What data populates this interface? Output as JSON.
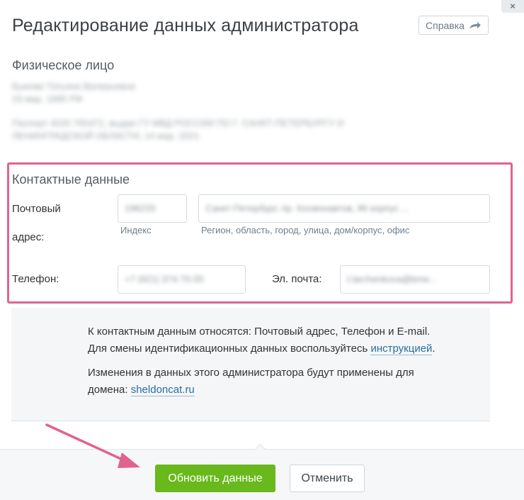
{
  "dialog": {
    "title": "Редактирование данных администратора",
    "help_label": "Справка",
    "close_label": "×"
  },
  "person": {
    "section_title": "Физическое лицо",
    "name_line": "Быкова Татьяна Валерьевна",
    "birth_line": "23 мар. 1995 РФ",
    "passport_line1": "Паспорт 4020 765472, выдан ГУ МВД РОССИИ ПО Г. САНКТ-ПЕТЕРБУРГУ И",
    "passport_line2": "ЛЕНИНГРАДСКОЙ ОБЛАСТИ, 14 мар. 2021"
  },
  "contacts": {
    "section_title": "Контактные данные",
    "postal_label_line1": "Почтовый",
    "postal_label_line2": "адрес:",
    "index_value": "196233",
    "index_hint": "Индекс",
    "address_value": "Санкт-Петербург, пр. Космонавтов, 86 корпус ...",
    "address_hint": "Регион, область, город, улица, дом/корпус, офис",
    "phone_label": "Телефон:",
    "phone_value": "+7 (921) 374-70-55",
    "email_label": "Эл. почта:",
    "email_value": "t.larchenkova@bme..."
  },
  "info": {
    "line1": "К контактным данным относятся: Почтовый адрес, Телефон и E-mail.",
    "line2_prefix": "Для смены идентификационных данных воспользуйтесь ",
    "line2_link": "инструкцией",
    "line2_suffix": ".",
    "line3": "Изменения в данных этого администратора будут применены для",
    "line4_prefix": "домена: ",
    "domain_link": "sheldoncat.ru"
  },
  "footer": {
    "update_label": "Обновить данные",
    "cancel_label": "Отменить"
  },
  "colors": {
    "highlight_border": "#e2628f",
    "primary_button": "#69b81c",
    "link": "#2a6e9e"
  }
}
